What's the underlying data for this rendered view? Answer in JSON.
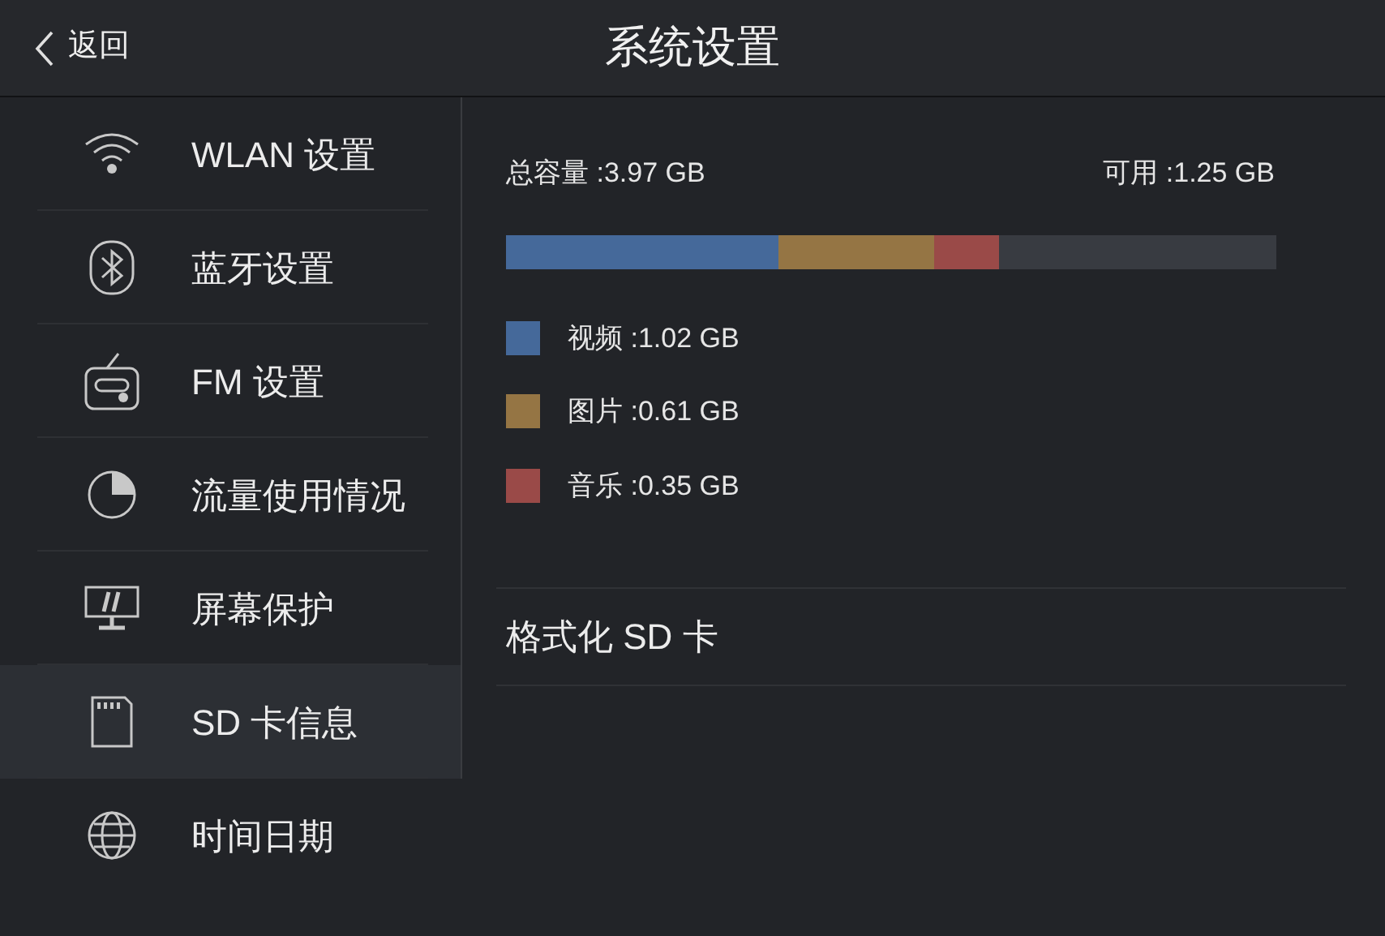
{
  "header": {
    "back_label": "返回",
    "title": "系统设置"
  },
  "sidebar": {
    "items": [
      {
        "label": "WLAN 设置",
        "selected": false
      },
      {
        "label": "蓝牙设置",
        "selected": false
      },
      {
        "label": "FM 设置",
        "selected": false
      },
      {
        "label": "流量使用情况",
        "selected": false
      },
      {
        "label": "屏幕保护",
        "selected": false
      },
      {
        "label": "SD 卡信息",
        "selected": true
      },
      {
        "label": "时间日期",
        "selected": false
      }
    ]
  },
  "storage": {
    "total": "总容量 :3.97 GB",
    "available": "可用 :1.25 GB",
    "segments": [
      {
        "label": "视频 :1.02 GB",
        "color": "#45699a"
      },
      {
        "label": "图片 :0.61 GB",
        "color": "#957544"
      },
      {
        "label": "音乐 :0.35 GB",
        "color": "#9a4a48"
      }
    ]
  },
  "format_label": "格式化 SD 卡"
}
